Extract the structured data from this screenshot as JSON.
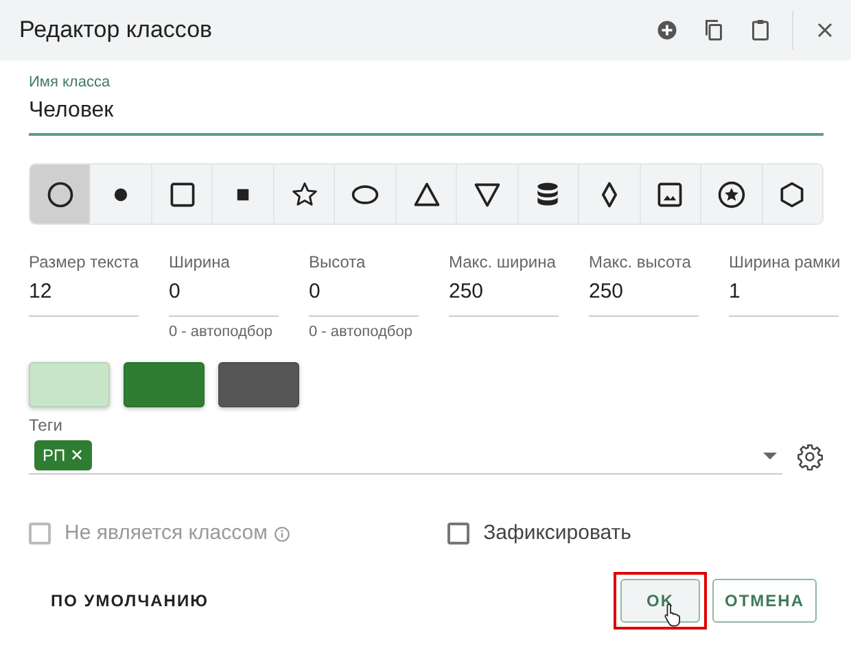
{
  "window": {
    "title": "Редактор классов"
  },
  "class_name": {
    "label": "Имя класса",
    "value": "Человек"
  },
  "shapes": [
    {
      "kind": "circle",
      "selected": true
    },
    {
      "kind": "dot",
      "selected": false
    },
    {
      "kind": "square",
      "selected": false
    },
    {
      "kind": "filled-square",
      "selected": false
    },
    {
      "kind": "star",
      "selected": false
    },
    {
      "kind": "ellipse",
      "selected": false
    },
    {
      "kind": "triangle",
      "selected": false
    },
    {
      "kind": "inverted-triangle",
      "selected": false
    },
    {
      "kind": "database",
      "selected": false
    },
    {
      "kind": "diamond",
      "selected": false
    },
    {
      "kind": "image",
      "selected": false
    },
    {
      "kind": "star-circle",
      "selected": false
    },
    {
      "kind": "hexagon",
      "selected": false
    }
  ],
  "fields": [
    {
      "label": "Размер текста",
      "value": "12"
    },
    {
      "label": "Ширина",
      "value": "0",
      "hint": "0 - автоподбор"
    },
    {
      "label": "Высота",
      "value": "0",
      "hint": "0 - автоподбор"
    },
    {
      "label": "Макс. ширина",
      "value": "250"
    },
    {
      "label": "Макс. высота",
      "value": "250"
    },
    {
      "label": "Ширина рамки",
      "value": "1"
    }
  ],
  "colors": [
    {
      "color": "#c8e6c9"
    },
    {
      "color": "#2e7d32"
    },
    {
      "color": "#555555"
    }
  ],
  "tags": {
    "label": "Теги",
    "chips": [
      {
        "text": "РП",
        "remove": "✕"
      }
    ]
  },
  "checkboxes": [
    {
      "label": "Не является классом",
      "checked": false,
      "disabled": true,
      "info": true
    },
    {
      "label": "Зафиксировать",
      "checked": false,
      "disabled": false
    }
  ],
  "buttons": [
    {
      "kind": "text",
      "label": "ПО УМОЛЧАНИЮ",
      "highlighted": false
    },
    {
      "kind": "outlined",
      "label": "OK",
      "highlighted": true
    },
    {
      "kind": "outlined",
      "label": "ОТМЕНА",
      "highlighted": false
    }
  ]
}
